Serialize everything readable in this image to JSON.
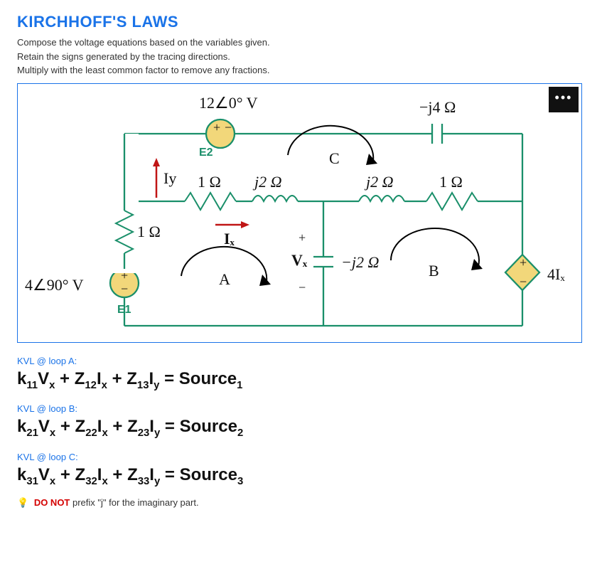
{
  "title": "KIRCHHOFF'S LAWS",
  "instructions": {
    "l1": "Compose the voltage equations based on the variables given.",
    "l2": "Retain the signs generated by the tracing directions.",
    "l3": "Multiply with the least common factor to remove any fractions."
  },
  "circuit": {
    "E2_value": "12∠0° V",
    "E2_label": "E2",
    "capacitor": "−j4 Ω",
    "Iy": "Iy",
    "R_1ohm_mid": "1 Ω",
    "L_j2_left": "j2 Ω",
    "L_j2_right": "j2 Ω",
    "R_1ohm_right": "1 Ω",
    "R_1ohm_left": "1 Ω",
    "Ix": "Iₓ",
    "Vx": "Vₓ",
    "plus": "+",
    "minus": "−",
    "cap_j2": "−j2 Ω",
    "E1_value": "4∠90° V",
    "E1_label": "E1",
    "depSrc": "4Iₓ",
    "loopA": "A",
    "loopB": "B",
    "loopC": "C",
    "dots": "•••"
  },
  "kvl": {
    "a_label": "KVL @ loop A:",
    "b_label": "KVL @ loop B:",
    "c_label": "KVL @ loop C:"
  },
  "equations": {
    "a": {
      "k": "k",
      "s11": "11",
      "v": "V",
      "sx": "x",
      "p1": " + Z",
      "s12": "12",
      "i": "I",
      "p2": " + Z",
      "s13": "13",
      "iy": "y",
      "eq": " = Source",
      "n": "1"
    },
    "b": {
      "s21": "21",
      "s22": "22",
      "s23": "23",
      "n": "2"
    },
    "c": {
      "s31": "31",
      "s32": "32",
      "s33": "33",
      "n": "3"
    }
  },
  "note": {
    "bulb": "💡",
    "dnot": "DO NOT",
    "rest": " prefix \"j\" for the imaginary part."
  }
}
